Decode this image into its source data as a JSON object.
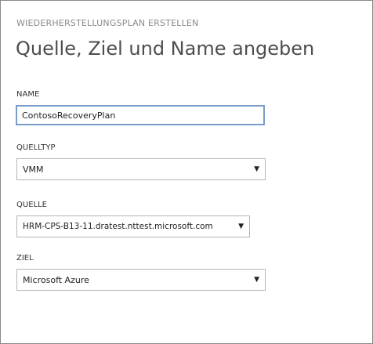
{
  "header": {
    "subtitle": "WIEDERHERSTELLUNGSPLAN ERSTELLEN",
    "title": "Quelle, Ziel und Name angeben"
  },
  "form": {
    "name": {
      "label": "NAME",
      "value": "ContosoRecoveryPlan"
    },
    "source_type": {
      "label": "QUELLTYP",
      "value": "VMM"
    },
    "source": {
      "label": "QUELLE",
      "value": "HRM-CPS-B13-11.dratest.nttest.microsoft.com"
    },
    "target": {
      "label": "ZIEL",
      "value": "Microsoft Azure"
    }
  },
  "icons": {
    "dropdown": "chevron-down-icon"
  },
  "colors": {
    "focus_border": "#7a9ccb",
    "field_border": "#b5b5b5",
    "title_text": "#4d4d4d",
    "subtitle_text": "#8a8a8a"
  }
}
